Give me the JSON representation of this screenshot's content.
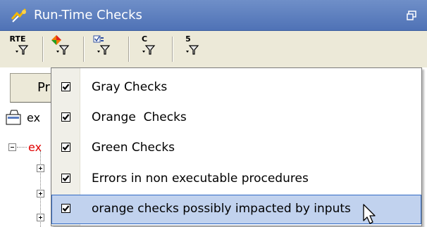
{
  "window": {
    "title": "Run-Time Checks",
    "title_icon": "runtime-checks-icon",
    "restore_icon": "restore-window-icon"
  },
  "toolbar": {
    "buttons": [
      {
        "label": "RTE",
        "icon": "filter-funnel-icon"
      },
      {
        "label": "",
        "icon": "color-filter-funnel-icon"
      },
      {
        "label": "",
        "icon": "check-filter-funnel-icon"
      },
      {
        "label": "C",
        "icon": "filter-funnel-icon"
      },
      {
        "label": "5",
        "icon": "filter-funnel-icon"
      }
    ]
  },
  "background": {
    "tab_label": "Pr",
    "tree_item_1": "ex",
    "tree_item_2": "ex"
  },
  "menu": {
    "items": [
      {
        "label": "Gray Checks",
        "checked": true
      },
      {
        "label": "Orange  Checks",
        "checked": true
      },
      {
        "label": "Green Checks",
        "checked": true
      },
      {
        "label": "Errors in non executable procedures",
        "checked": true
      },
      {
        "label": "orange checks possibly impacted by inputs",
        "checked": true,
        "highlighted": true
      }
    ]
  },
  "colors": {
    "titlebar": "#5a7cc0",
    "highlight": "#c1d2ee",
    "tree_error": "#e00000"
  }
}
